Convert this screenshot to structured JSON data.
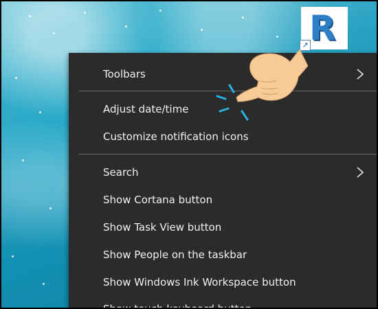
{
  "desktop": {
    "shortcut_icon_name": "revit-r-icon",
    "shortcut_letter": "R",
    "shortcut_arrow_glyph": "↗",
    "accent_color": "#2f7fc7"
  },
  "context_menu": {
    "background_color": "#2b2b2b",
    "text_color": "#f2f2f2",
    "items": [
      {
        "label": "Toolbars",
        "has_submenu": true
      },
      {
        "label": "Adjust date/time",
        "has_submenu": false
      },
      {
        "label": "Customize notification icons",
        "has_submenu": false
      },
      {
        "label": "Search",
        "has_submenu": true
      },
      {
        "label": "Show Cortana button",
        "has_submenu": false
      },
      {
        "label": "Show Task View button",
        "has_submenu": false
      },
      {
        "label": "Show People on the taskbar",
        "has_submenu": false
      },
      {
        "label": "Show Windows Ink Workspace button",
        "has_submenu": false
      },
      {
        "label": "Show touch keyboard button",
        "has_submenu": false
      }
    ]
  },
  "pointer": {
    "icon_name": "pointing-hand-icon",
    "tap_indicator_color": "#28b4e6",
    "skin_color": "#f6cb98"
  }
}
